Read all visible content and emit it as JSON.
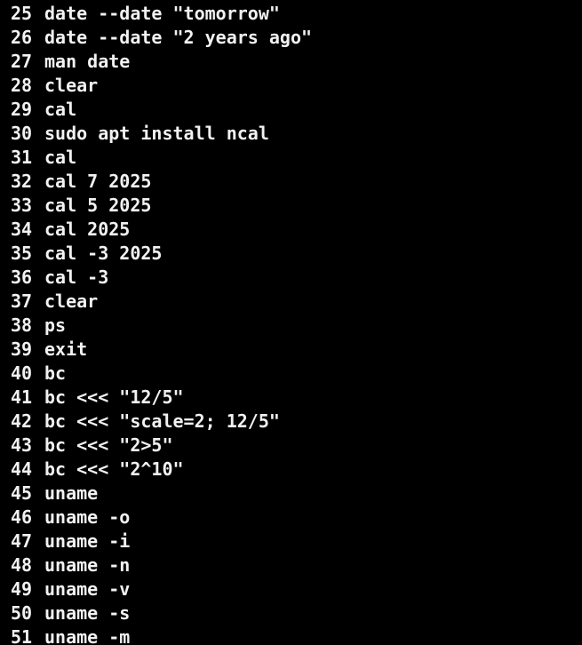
{
  "terminal": {
    "colors": {
      "background": "#000000",
      "foreground": "#f2f2f2"
    },
    "history": [
      {
        "num": "25",
        "cmd": "date --date \"tomorrow\""
      },
      {
        "num": "26",
        "cmd": "date --date \"2 years ago\""
      },
      {
        "num": "27",
        "cmd": "man date"
      },
      {
        "num": "28",
        "cmd": "clear"
      },
      {
        "num": "29",
        "cmd": "cal"
      },
      {
        "num": "30",
        "cmd": "sudo apt install ncal"
      },
      {
        "num": "31",
        "cmd": "cal"
      },
      {
        "num": "32",
        "cmd": "cal 7 2025"
      },
      {
        "num": "33",
        "cmd": "cal 5 2025"
      },
      {
        "num": "34",
        "cmd": "cal 2025"
      },
      {
        "num": "35",
        "cmd": "cal -3 2025"
      },
      {
        "num": "36",
        "cmd": "cal -3"
      },
      {
        "num": "37",
        "cmd": "clear"
      },
      {
        "num": "38",
        "cmd": "ps"
      },
      {
        "num": "39",
        "cmd": "exit"
      },
      {
        "num": "40",
        "cmd": "bc"
      },
      {
        "num": "41",
        "cmd": "bc <<< \"12/5\""
      },
      {
        "num": "42",
        "cmd": "bc <<< \"scale=2; 12/5\""
      },
      {
        "num": "43",
        "cmd": "bc <<< \"2>5\""
      },
      {
        "num": "44",
        "cmd": "bc <<< \"2^10\""
      },
      {
        "num": "45",
        "cmd": "uname"
      },
      {
        "num": "46",
        "cmd": "uname -o"
      },
      {
        "num": "47",
        "cmd": "uname -i"
      },
      {
        "num": "48",
        "cmd": "uname -n"
      },
      {
        "num": "49",
        "cmd": "uname -v"
      },
      {
        "num": "50",
        "cmd": "uname -s"
      },
      {
        "num": "51",
        "cmd": "uname -m"
      }
    ]
  }
}
